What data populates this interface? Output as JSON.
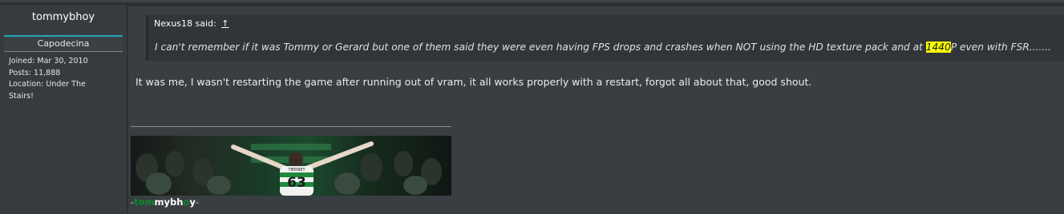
{
  "user": {
    "name": "tommybhoy",
    "title": "Capodecina",
    "info": [
      "Joined: Mar 30, 2010",
      "Posts: 11,888",
      "Location: Under The",
      "Stairs!"
    ]
  },
  "quote": {
    "author": "Nexus18 said:",
    "arrow": "↑",
    "text_before": "I can't remember if it was Tommy or Gerard but one of them said they were even having FPS drops and crashes when NOT using the HD texture pack and at ",
    "highlight": "1440",
    "text_after": "P even with FSR......."
  },
  "message": "It was me, I wasn't restarting the game after running out of vram, it all works properly with a restart, forgot all about that, good shout.",
  "signature": {
    "banner_number": "63",
    "banner_name": "TIERNEY",
    "prefix": "-",
    "green": "tom",
    "white1": "mybh",
    "green2": "o",
    "white2": "y",
    "suffix": "-"
  }
}
